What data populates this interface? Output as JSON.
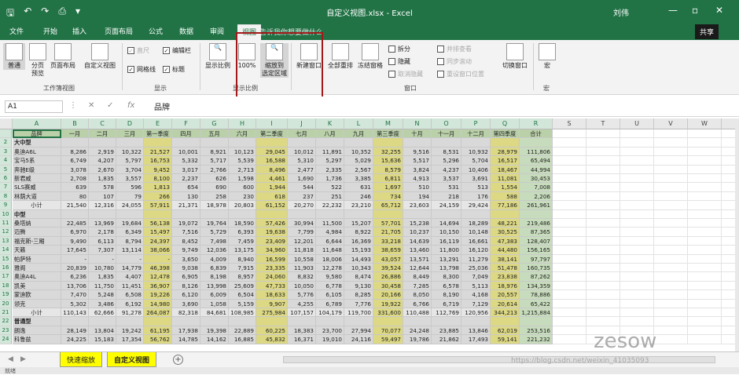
{
  "titlebar": {
    "filename": "自定义视图.xlsx - Excel",
    "user": "刘伟",
    "minimize": "—",
    "restore": "▫",
    "close": "✕"
  },
  "tabs": [
    "文件",
    "开始",
    "插入",
    "页面布局",
    "公式",
    "数据",
    "审阅",
    "视图"
  ],
  "tell_me": "告诉我你想要做什么",
  "share": "共享",
  "ribbon": {
    "workbook_views": {
      "normal": "普通",
      "page_break": "分页\n预览",
      "page_layout": "页面布局",
      "custom_views": "自定义视图",
      "label": "工作簿视图"
    },
    "show": {
      "ruler": "直尺",
      "formula_bar": "编辑栏",
      "gridlines": "网格线",
      "headings": "标题",
      "label": "显示"
    },
    "zoom": {
      "zoom": "显示比例",
      "zoom100": "100%",
      "zoom_selection": "缩放到\n选定区域",
      "label": "显示比例"
    },
    "window": {
      "new_window": "新建窗口",
      "arrange_all": "全部重排",
      "freeze": "冻结窗格",
      "split": "拆分",
      "hide": "隐藏",
      "unhide": "取消隐藏",
      "side_by_side": "并排查看",
      "sync_scroll": "同步滚动",
      "reset_pos": "重设窗口位置",
      "switch": "切换窗口",
      "label": "窗口"
    },
    "macros": {
      "macros": "宏",
      "label": "宏"
    }
  },
  "formula_bar": {
    "cell": "A1",
    "value": "品牌"
  },
  "columns": [
    "A",
    "B",
    "C",
    "D",
    "E",
    "F",
    "G",
    "H",
    "I",
    "J",
    "K",
    "L",
    "M",
    "N",
    "O",
    "P",
    "Q",
    "R",
    "S",
    "T",
    "U",
    "V",
    "W",
    "X",
    "Y",
    "Z"
  ],
  "header_row": [
    "品牌",
    "一月",
    "二月",
    "三月",
    "第一季度",
    "四月",
    "五月",
    "六月",
    "第二季度",
    "七月",
    "八月",
    "九月",
    "第三季度",
    "十月",
    "十一月",
    "十二月",
    "第四季度",
    "合计"
  ],
  "rows": [
    {
      "n": "2",
      "type": "section",
      "cells": [
        "大中型"
      ]
    },
    {
      "n": "3",
      "type": "data",
      "cells": [
        "奥迪A6L",
        "8,286",
        "2,919",
        "10,322",
        "21,527",
        "10,001",
        "8,921",
        "10,123",
        "29,045",
        "10,012",
        "11,891",
        "10,352",
        "32,255",
        "9,516",
        "8,531",
        "10,932",
        "28,979",
        "111,806"
      ]
    },
    {
      "n": "4",
      "type": "data",
      "cells": [
        "宝马5系",
        "6,749",
        "4,207",
        "5,797",
        "16,753",
        "5,332",
        "5,717",
        "5,539",
        "16,588",
        "5,310",
        "5,297",
        "5,029",
        "15,636",
        "5,517",
        "5,296",
        "5,704",
        "16,517",
        "65,494"
      ]
    },
    {
      "n": "5",
      "type": "data",
      "cells": [
        "奔驰E级",
        "3,078",
        "2,670",
        "3,704",
        "9,452",
        "3,017",
        "2,766",
        "2,713",
        "8,496",
        "2,477",
        "2,335",
        "2,567",
        "8,579",
        "3,824",
        "4,237",
        "10,406",
        "18,467",
        "44,994"
      ]
    },
    {
      "n": "6",
      "type": "data",
      "cells": [
        "新君威",
        "2,708",
        "1,835",
        "3,557",
        "8,100",
        "2,237",
        "626",
        "1,598",
        "4,461",
        "1,690",
        "1,736",
        "3,385",
        "6,811",
        "4,913",
        "3,537",
        "3,691",
        "11,081",
        "30,453"
      ]
    },
    {
      "n": "7",
      "type": "data",
      "cells": [
        "SLS赛威",
        "639",
        "578",
        "596",
        "1,813",
        "654",
        "690",
        "600",
        "1,944",
        "544",
        "522",
        "631",
        "1,697",
        "510",
        "531",
        "513",
        "1,554",
        "7,008"
      ]
    },
    {
      "n": "8",
      "type": "data",
      "cells": [
        "林荫大道",
        "80",
        "107",
        "79",
        "266",
        "130",
        "258",
        "230",
        "618",
        "237",
        "251",
        "246",
        "734",
        "194",
        "218",
        "176",
        "588",
        "2,206"
      ]
    },
    {
      "n": "9",
      "type": "subtotal",
      "cells": [
        "小计",
        "21,540",
        "12,316",
        "24,055",
        "57,911",
        "21,371",
        "18,978",
        "20,803",
        "61,152",
        "20,270",
        "22,232",
        "23,210",
        "65,712",
        "23,603",
        "24,159",
        "29,424",
        "77,186",
        "261,961"
      ]
    },
    {
      "n": "10",
      "type": "section",
      "cells": [
        "中型"
      ]
    },
    {
      "n": "11",
      "type": "data",
      "cells": [
        "桑塔纳",
        "22,485",
        "13,969",
        "19,684",
        "56,138",
        "19,072",
        "19,764",
        "18,590",
        "57,426",
        "30,994",
        "11,500",
        "15,207",
        "57,701",
        "15,238",
        "14,694",
        "18,289",
        "48,221",
        "219,486"
      ]
    },
    {
      "n": "12",
      "type": "data",
      "cells": [
        "迈腾",
        "6,970",
        "2,178",
        "6,349",
        "15,497",
        "7,516",
        "5,729",
        "6,393",
        "19,638",
        "7,799",
        "4,984",
        "8,922",
        "21,705",
        "10,237",
        "10,150",
        "10,148",
        "30,525",
        "87,365"
      ]
    },
    {
      "n": "13",
      "type": "data",
      "cells": [
        "福克斯-三厢",
        "9,490",
        "6,113",
        "8,794",
        "24,397",
        "8,452",
        "7,498",
        "7,459",
        "23,409",
        "12,201",
        "6,644",
        "16,369",
        "33,218",
        "14,639",
        "16,119",
        "16,661",
        "47,383",
        "128,407"
      ]
    },
    {
      "n": "14",
      "type": "data",
      "cells": [
        "天籁",
        "17,645",
        "7,307",
        "13,114",
        "38,066",
        "9,749",
        "12,036",
        "13,175",
        "34,960",
        "11,818",
        "11,648",
        "15,193",
        "38,659",
        "13,460",
        "11,800",
        "16,120",
        "44,480",
        "156,165"
      ]
    },
    {
      "n": "15",
      "type": "data",
      "cells": [
        "帕萨特",
        "-",
        "-",
        "-",
        "-",
        "3,650",
        "4,009",
        "8,940",
        "16,599",
        "10,558",
        "18,006",
        "14,493",
        "43,057",
        "13,571",
        "13,291",
        "11,279",
        "38,141",
        "97,797"
      ]
    },
    {
      "n": "16",
      "type": "data",
      "cells": [
        "雅阁",
        "20,839",
        "10,780",
        "14,779",
        "46,398",
        "9,038",
        "6,839",
        "7,915",
        "23,335",
        "11,903",
        "12,278",
        "10,343",
        "39,524",
        "12,644",
        "13,798",
        "25,036",
        "51,478",
        "160,735"
      ]
    },
    {
      "n": "17",
      "type": "data",
      "cells": [
        "奥迪A4L",
        "6,236",
        "1,835",
        "4,407",
        "12,478",
        "6,905",
        "8,198",
        "8,957",
        "24,060",
        "8,832",
        "9,580",
        "8,474",
        "26,886",
        "8,449",
        "8,300",
        "7,049",
        "23,838",
        "87,262"
      ]
    },
    {
      "n": "18",
      "type": "data",
      "cells": [
        "凯美",
        "13,706",
        "11,750",
        "11,451",
        "36,907",
        "8,126",
        "13,998",
        "25,609",
        "47,733",
        "10,050",
        "6,778",
        "9,130",
        "30,458",
        "7,285",
        "6,578",
        "5,113",
        "18,976",
        "134,359"
      ]
    },
    {
      "n": "19",
      "type": "data",
      "cells": [
        "蒙迪欧",
        "7,470",
        "5,248",
        "6,508",
        "19,226",
        "6,120",
        "6,009",
        "6,504",
        "18,633",
        "5,776",
        "6,105",
        "8,285",
        "20,166",
        "8,050",
        "8,190",
        "4,168",
        "20,557",
        "78,886"
      ]
    },
    {
      "n": "20",
      "type": "data",
      "cells": [
        "领克",
        "5,302",
        "3,486",
        "6,192",
        "14,980",
        "3,690",
        "1,058",
        "5,159",
        "9,907",
        "4,255",
        "6,789",
        "7,776",
        "19,922",
        "6,766",
        "6,719",
        "7,129",
        "20,614",
        "65,422"
      ]
    },
    {
      "n": "21",
      "type": "subtotal",
      "cells": [
        "小计",
        "110,143",
        "62,666",
        "91,278",
        "264,087",
        "82,318",
        "84,681",
        "108,985",
        "275,984",
        "107,157",
        "104,179",
        "119,700",
        "331,600",
        "110,488",
        "112,769",
        "120,956",
        "344,213",
        "1,215,884"
      ]
    },
    {
      "n": "22",
      "type": "section",
      "cells": [
        "普通型"
      ]
    },
    {
      "n": "23",
      "type": "data",
      "cells": [
        "朗逸",
        "28,149",
        "13,804",
        "19,242",
        "61,195",
        "17,938",
        "19,398",
        "22,889",
        "60,225",
        "18,383",
        "23,700",
        "27,994",
        "70,077",
        "24,248",
        "23,885",
        "13,846",
        "62,019",
        "253,516"
      ]
    },
    {
      "n": "24",
      "type": "data",
      "cells": [
        "科鲁兹",
        "24,225",
        "15,183",
        "17,354",
        "56,762",
        "14,785",
        "14,162",
        "16,885",
        "45,832",
        "16,371",
        "19,010",
        "24,116",
        "59,497",
        "19,786",
        "21,862",
        "17,493",
        "59,141",
        "221,232"
      ]
    }
  ],
  "sheets": [
    "快速缩放",
    "自定义视图"
  ],
  "add_sheet": "+",
  "status": "就绪",
  "watermark": "https://blog.csdn.net/weixin_41035093",
  "logo": "zesow"
}
